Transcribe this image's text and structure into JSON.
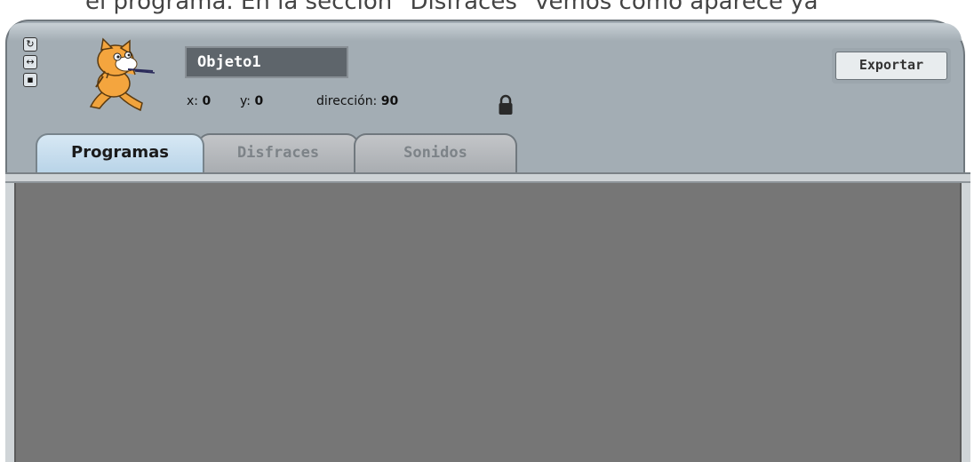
{
  "caption_fragment": "el programa. En la sección \"Disfraces\" vemos como aparece ya",
  "sprite": {
    "name": "Objeto1",
    "x_label": "x:",
    "x_value": "0",
    "y_label": "y:",
    "y_value": "0",
    "direction_label": "dirección:",
    "direction_value": "90"
  },
  "rotation_buttons": [
    {
      "icon": "rotate-icon",
      "glyph": "↻"
    },
    {
      "icon": "flip-left-right-icon",
      "glyph": "↔"
    },
    {
      "icon": "no-rotate-icon",
      "glyph": "▪"
    }
  ],
  "export_label": "Exportar",
  "tabs": [
    {
      "label": "Programas",
      "active": true
    },
    {
      "label": "Disfraces",
      "active": false
    },
    {
      "label": "Sonidos",
      "active": false
    }
  ],
  "colors": {
    "panel": "#a3adb4",
    "active_tab": "#b9d4e8",
    "script_area": "#767676",
    "name_field": "#5e656b"
  }
}
